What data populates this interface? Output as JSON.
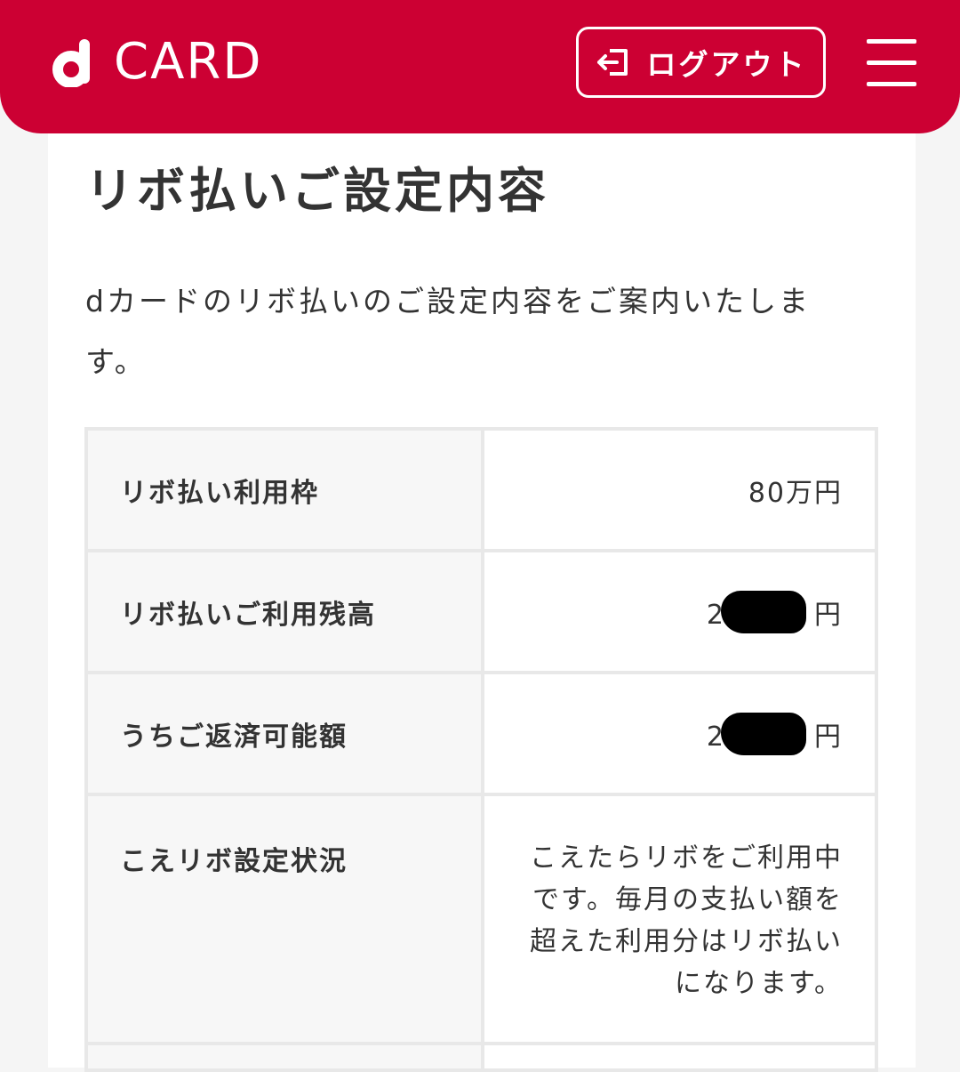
{
  "header": {
    "logo_text": "CARD",
    "logout_label": "ログアウト",
    "brand_color": "#cc0033"
  },
  "icons": {
    "logout": "logout-icon",
    "menu": "hamburger-menu-icon"
  },
  "main": {
    "title": "リボ払いご設定内容",
    "intro": "dカードのリボ払いのご設定内容をご案内いたします。",
    "rows": [
      {
        "label": "リボ払い利用枠",
        "value": "80万円"
      },
      {
        "label": "リボ払いご利用残高",
        "value_visible": "2",
        "value_suffix": "円"
      },
      {
        "label": "うちご返済可能額",
        "value_visible": "2",
        "value_suffix": "円"
      },
      {
        "label": "こえリボ設定状況",
        "value": "こえたらリボをご利用中です。毎月の支払い額を超えた利用分はリボ払いになります。"
      }
    ]
  }
}
